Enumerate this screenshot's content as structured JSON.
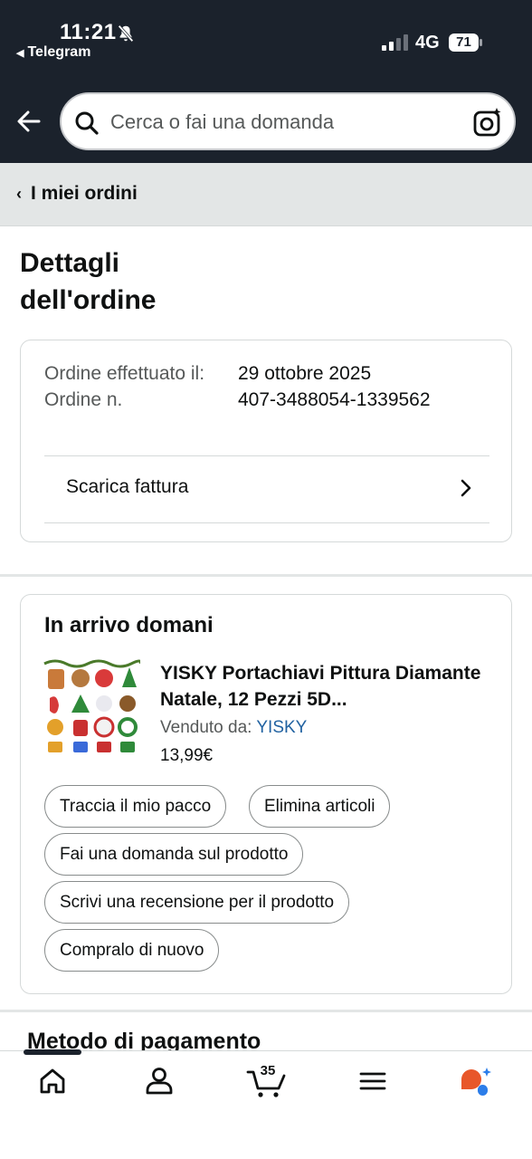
{
  "status_bar": {
    "time": "11:21",
    "back_app": "Telegram",
    "network": "4G",
    "battery": "71"
  },
  "search": {
    "placeholder": "Cerca o fai una domanda"
  },
  "breadcrumb": {
    "label": "I miei ordini"
  },
  "page": {
    "title": "Dettagli dell'ordine"
  },
  "order_info": {
    "placed_label": "Ordine effettuato il:",
    "number_label": "Ordine n.",
    "placed_value": "29 ottobre 2025",
    "number_value": "407-3488054-1339562",
    "invoice_label": "Scarica fattura"
  },
  "shipment": {
    "title": "In arrivo domani",
    "product": {
      "title": "YISKY Portachiavi Pittura Diamante Natale, 12 Pezzi 5D...",
      "sold_by_label": "Venduto da:",
      "seller": "YISKY",
      "price": "13,99€"
    },
    "actions": [
      {
        "label": "Traccia il mio pacco"
      },
      {
        "label": "Elimina articoli"
      },
      {
        "label": "Fai una domanda sul prodotto"
      },
      {
        "label": "Scrivi una recensione per il prodotto"
      },
      {
        "label": "Compralo di nuovo"
      }
    ]
  },
  "payment": {
    "title": "Metodo di pagamento"
  },
  "tabbar": {
    "items": [
      "home-icon",
      "account-icon",
      "cart-icon",
      "menu-icon",
      "assistant-icon"
    ],
    "cart_count": "35"
  },
  "colors": {
    "header_bg": "#1b222c",
    "link": "#2162a1",
    "crumb_bg": "#e3e6e6",
    "assistant_orange": "#e8572a",
    "assistant_blue": "#2b7de9"
  }
}
